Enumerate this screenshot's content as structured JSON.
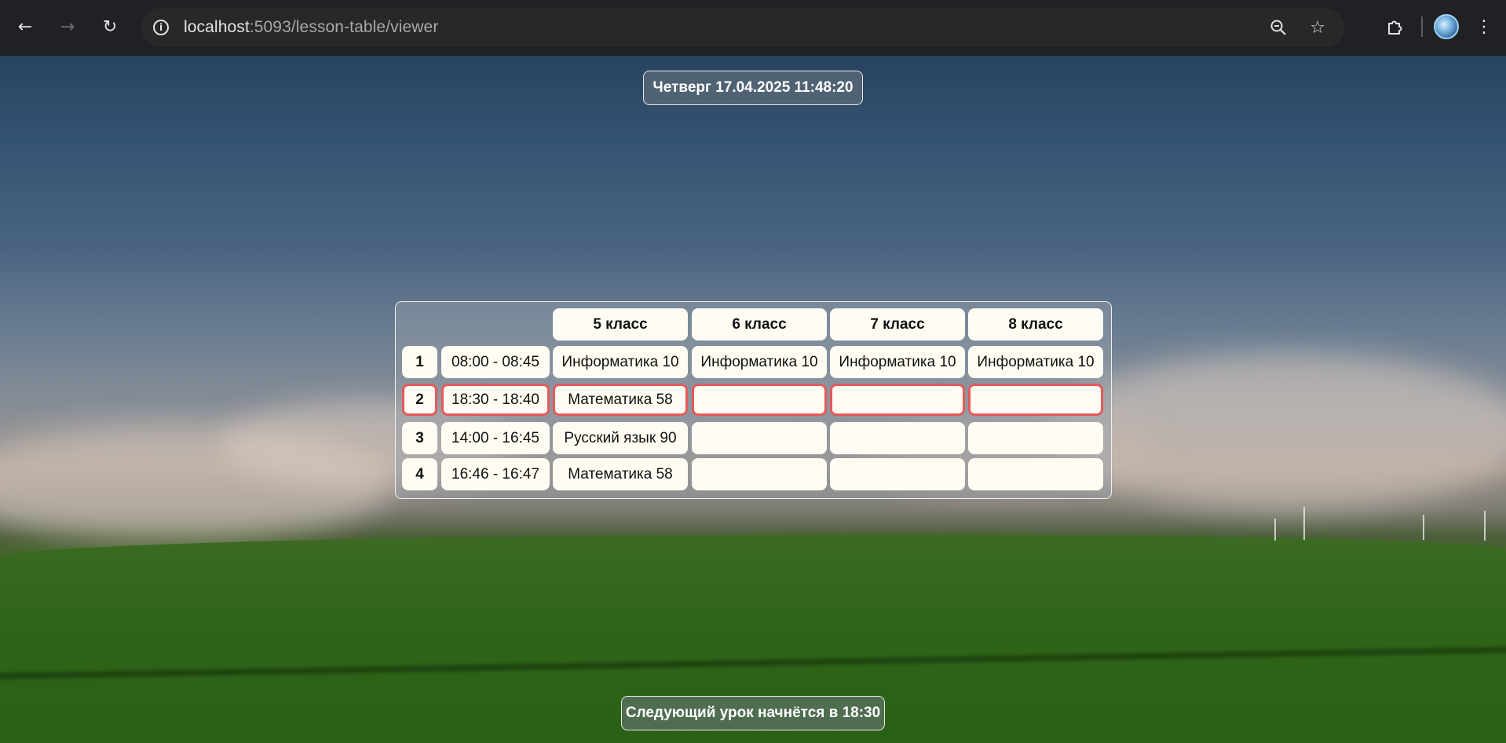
{
  "browser": {
    "url_host": "localhost",
    "url_rest": ":5093/lesson-table/viewer",
    "back_icon": "arrow-left-icon",
    "forward_icon": "arrow-right-icon",
    "reload_icon": "reload-icon",
    "info_icon": "info-icon",
    "zoom_icon": "zoom-out-icon",
    "bookmark_icon": "star-icon",
    "extensions_icon": "puzzle-icon",
    "menu_icon": "kebab-menu-icon"
  },
  "datetime": "Четверг 17.04.2025 11:48:20",
  "timetable": {
    "columns": [
      "5 класс",
      "6 класс",
      "7 класс",
      "8 класс"
    ],
    "rows": [
      {
        "number": "1",
        "time": "08:00 - 08:45",
        "cells": [
          "Информатика 10",
          "Информатика 10",
          "Информатика 10",
          "Информатика 10"
        ]
      },
      {
        "number": "2",
        "time": "18:30 - 18:40",
        "cells": [
          "Математика 58",
          "",
          "",
          ""
        ]
      },
      {
        "number": "3",
        "time": "14:00 - 16:45",
        "cells": [
          "Русский язык 90",
          "",
          "",
          ""
        ]
      },
      {
        "number": "4",
        "time": "16:46 - 16:47",
        "cells": [
          "Математика 58",
          "",
          "",
          ""
        ]
      }
    ],
    "highlighted_row": "2",
    "highlight_color": "#e45a5a",
    "cell_background": "#fffdf3"
  },
  "next_lesson": "Следующий урок начнётся в 18:30"
}
